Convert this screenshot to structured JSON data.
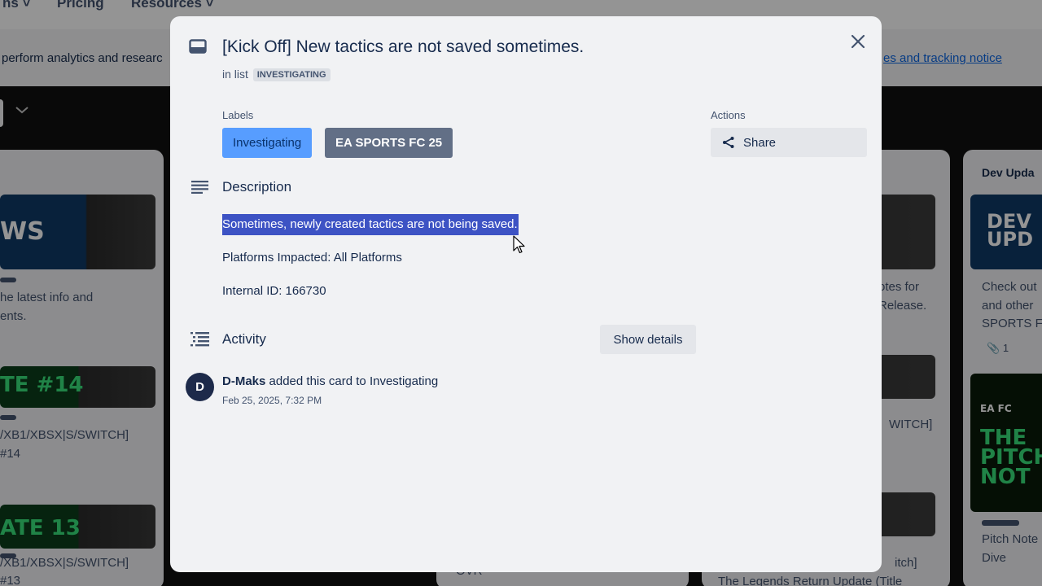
{
  "background": {
    "nav": [
      "ns",
      "Pricing",
      "Resources"
    ],
    "cookie_text": "perform analytics and researc",
    "cookie_link": "es and tracking notice",
    "list1": {
      "banner": "WS",
      "text1": "he latest info and",
      "text2": "ents.",
      "update14": "TE #14",
      "plat1": "/XB1/XBSX|S/SWITCH]",
      "plat1b": "#14",
      "update13": "ATE 13",
      "plat2": "/XB1/XBSX|S/SWITCH]",
      "plat2b": "#13"
    },
    "list3": {
      "text1": "otes for",
      "text2": "Release.",
      "text3": "WITCH]",
      "text4": "itch]",
      "text5": "The Legends Return Update (Title"
    },
    "list2": {
      "text1": "OVR"
    },
    "list4": {
      "header": "Dev Upda",
      "banner": "DEV UPD",
      "text1": "Check out",
      "text2": "and other",
      "text3": "SPORTS FC",
      "attach": "1",
      "logo": "EA FC",
      "pitch1": "THE",
      "pitch2": "PITCH",
      "pitch3": "NOT",
      "text4": "Pitch Note",
      "text5": "Dive"
    }
  },
  "card": {
    "title": "[Kick Off] New tactics are not saved sometimes.",
    "in_list_prefix": "in list",
    "list_name": "INVESTIGATING",
    "labels_heading": "Labels",
    "labels": [
      "Investigating",
      "EA SPORTS FC 25"
    ],
    "actions_heading": "Actions",
    "share_label": "Share",
    "description_heading": "Description",
    "description": [
      "Sometimes, newly created tactics are not being saved.",
      "Platforms Impacted: All Platforms",
      "Internal ID: 166730"
    ],
    "activity_heading": "Activity",
    "show_details_label": "Show details",
    "activity": {
      "avatar_initial": "D",
      "user": "D-Maks",
      "action": " added this card to Investigating",
      "timestamp": "Feb 25, 2025, 7:32 PM"
    }
  },
  "icons": [
    "card-icon",
    "close-icon",
    "share-icon",
    "description-icon",
    "activity-icon",
    "cursor-icon",
    "chevron-down-icon",
    "attachment-icon"
  ],
  "colors": {
    "label_investigating": "#579dff",
    "label_easports": "#626f86",
    "selection": "#3d53c4",
    "avatar": "#1d2a4a"
  }
}
